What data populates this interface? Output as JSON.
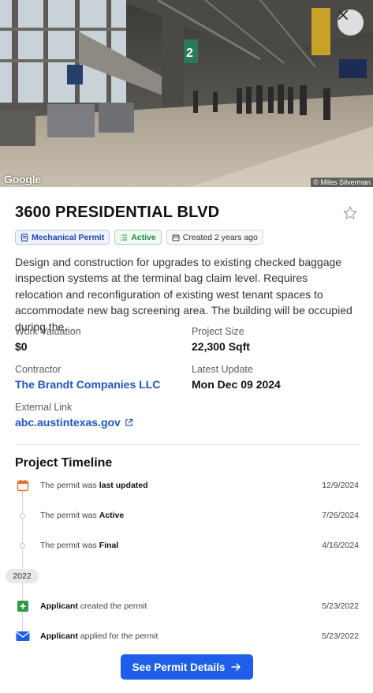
{
  "photo": {
    "google_logo": "Google",
    "credit": "© Miles Silverman",
    "close_icon": "close-icon"
  },
  "permit": {
    "address": "3600 PRESIDENTIAL BLVD",
    "badges": {
      "type": "Mechanical Permit",
      "status": "Active",
      "created": "Created 2 years ago"
    },
    "description": "Design and construction for upgrades to existing checked baggage inspection systems at the terminal bag claim level. Requires relocation and reconfiguration of existing west tenant spaces to accommodate new bag screening area. The building will be occupied during the...",
    "fields": {
      "work_valuation_label": "Work Valuation",
      "work_valuation_value": "$0",
      "project_size_label": "Project Size",
      "project_size_value": "22,300 Sqft",
      "contractor_label": "Contractor",
      "contractor_value": "The Brandt Companies LLC",
      "latest_update_label": "Latest Update",
      "latest_update_value": "Mon Dec 09 2024",
      "external_link_label": "External Link",
      "external_link_value": "abc.austintexas.gov"
    }
  },
  "timeline": {
    "title": "Project Timeline",
    "events": [
      {
        "prefix": "The permit was ",
        "bold": "last updated",
        "suffix": "",
        "date": "12/9/2024",
        "icon": "calendar-icon"
      },
      {
        "prefix": "The permit was ",
        "bold": "Active",
        "suffix": "",
        "date": "7/26/2024",
        "icon": "dot-icon"
      },
      {
        "prefix": "The permit was ",
        "bold": "Final",
        "suffix": "",
        "date": "4/16/2024",
        "icon": "dot-icon"
      },
      {
        "prefix": "",
        "bold": "Applicant",
        "suffix": " created the permit",
        "date": "5/23/2022",
        "icon": "plus-icon"
      },
      {
        "prefix": "",
        "bold": "Applicant",
        "suffix": " applied for the permit",
        "date": "5/23/2022",
        "icon": "mail-icon"
      }
    ],
    "year_marker": "2022"
  },
  "cta": {
    "label": "See Permit Details"
  },
  "colors": {
    "accent": "#1f5ee8",
    "link": "#1f55c7",
    "active_green": "#23853e",
    "calendar_orange": "#e8702a",
    "plus_green": "#2d9a4a",
    "mail_blue": "#1f5ee8"
  }
}
